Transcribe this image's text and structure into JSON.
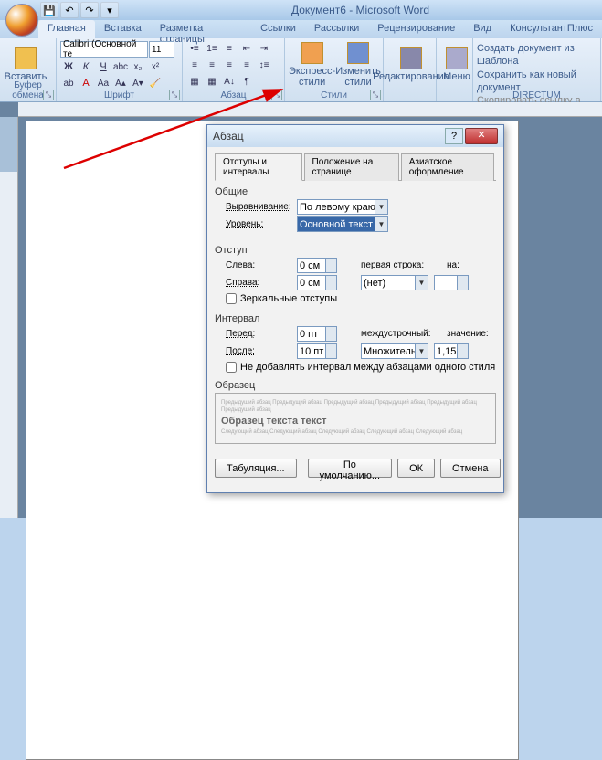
{
  "app": {
    "title": "Документ6 - Microsoft Word"
  },
  "ribbon": {
    "tabs": [
      "Главная",
      "Вставка",
      "Разметка страницы",
      "Ссылки",
      "Рассылки",
      "Рецензирование",
      "Вид",
      "КонсультантПлюс"
    ],
    "clipboard": {
      "label": "Буфер обмена",
      "paste": "Вставить"
    },
    "font": {
      "label": "Шрифт",
      "family": "Calibri (Основной те",
      "size": "11"
    },
    "paragraph": {
      "label": "Абзац"
    },
    "styles": {
      "label": "Стили",
      "express": "Экспресс-стили",
      "change": "Изменить стили"
    },
    "editing": {
      "label": "Редактирование"
    },
    "menu": {
      "label": "Меню"
    },
    "directum": {
      "label": "DIRECTUM",
      "create": "Создать документ из шаблона",
      "save": "Сохранить как новый документ",
      "copy": "Скопировать ссылку в буфер"
    }
  },
  "dialog": {
    "title": "Абзац",
    "tabs": [
      "Отступы и интервалы",
      "Положение на странице",
      "Азиатское оформление"
    ],
    "general": {
      "label": "Общие",
      "align_label": "Выравнивание:",
      "align_value": "По левому краю",
      "level_label": "Уровень:",
      "level_value": "Основной текст"
    },
    "indent": {
      "label": "Отступ",
      "left_label": "Слева:",
      "left_value": "0 см",
      "right_label": "Справа:",
      "right_value": "0 см",
      "first_label": "первая строка:",
      "first_value": "(нет)",
      "by_label": "на:",
      "mirror": "Зеркальные отступы"
    },
    "spacing": {
      "label": "Интервал",
      "before_label": "Перед:",
      "before_value": "0 пт",
      "after_label": "После:",
      "after_value": "10 пт",
      "line_label": "междустрочный:",
      "line_value": "Множитель",
      "at_label": "значение:",
      "at_value": "1,15",
      "nosame": "Не добавлять интервал между абзацами одного стиля"
    },
    "preview_label": "Образец",
    "buttons": {
      "tabs": "Табуляция...",
      "default": "По умолчанию...",
      "ok": "ОК",
      "cancel": "Отмена"
    }
  }
}
